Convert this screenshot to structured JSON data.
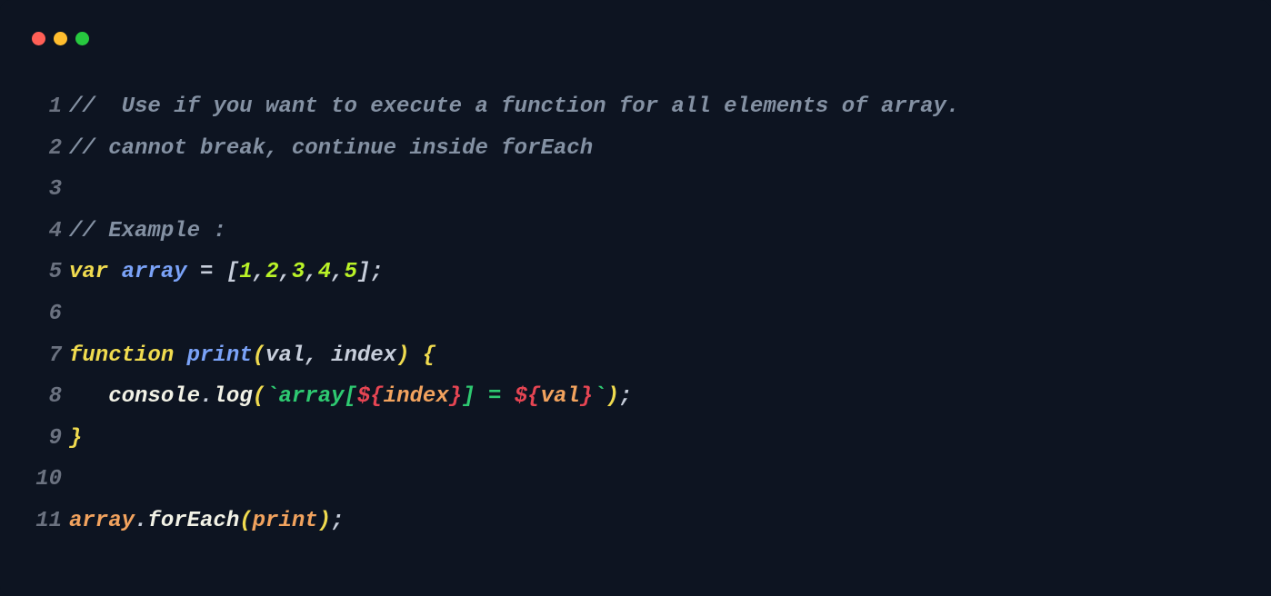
{
  "window": {
    "traffic_lights": [
      "close",
      "minimize",
      "maximize"
    ]
  },
  "code": {
    "lines": [
      {
        "n": "1",
        "tokens": [
          {
            "c": "tok-comment",
            "t": "//  Use if you want to execute a function for all elements of array."
          }
        ]
      },
      {
        "n": "2",
        "tokens": [
          {
            "c": "tok-comment",
            "t": "// cannot break, continue inside forEach"
          }
        ]
      },
      {
        "n": "3",
        "tokens": []
      },
      {
        "n": "4",
        "tokens": [
          {
            "c": "tok-comment",
            "t": "// Example :"
          }
        ]
      },
      {
        "n": "5",
        "tokens": [
          {
            "c": "tok-keyword",
            "t": "var"
          },
          {
            "c": "tok-default",
            "t": " "
          },
          {
            "c": "tok-var",
            "t": "array"
          },
          {
            "c": "tok-default",
            "t": " "
          },
          {
            "c": "tok-punct",
            "t": "="
          },
          {
            "c": "tok-default",
            "t": " "
          },
          {
            "c": "tok-punct",
            "t": "["
          },
          {
            "c": "tok-number",
            "t": "1"
          },
          {
            "c": "tok-punct",
            "t": ","
          },
          {
            "c": "tok-number",
            "t": "2"
          },
          {
            "c": "tok-punct",
            "t": ","
          },
          {
            "c": "tok-number",
            "t": "3"
          },
          {
            "c": "tok-punct",
            "t": ","
          },
          {
            "c": "tok-number",
            "t": "4"
          },
          {
            "c": "tok-punct",
            "t": ","
          },
          {
            "c": "tok-number",
            "t": "5"
          },
          {
            "c": "tok-punct",
            "t": "];"
          }
        ]
      },
      {
        "n": "6",
        "tokens": []
      },
      {
        "n": "7",
        "tokens": [
          {
            "c": "tok-keyword",
            "t": "function"
          },
          {
            "c": "tok-default",
            "t": " "
          },
          {
            "c": "tok-funcname",
            "t": "print"
          },
          {
            "c": "tok-paren",
            "t": "("
          },
          {
            "c": "tok-param",
            "t": "val"
          },
          {
            "c": "tok-punct",
            "t": ","
          },
          {
            "c": "tok-default",
            "t": " "
          },
          {
            "c": "tok-param",
            "t": "index"
          },
          {
            "c": "tok-paren",
            "t": ")"
          },
          {
            "c": "tok-default",
            "t": " "
          },
          {
            "c": "tok-brace",
            "t": "{"
          }
        ]
      },
      {
        "n": "8",
        "tokens": [
          {
            "c": "tok-default",
            "t": "   "
          },
          {
            "c": "tok-obj",
            "t": "console"
          },
          {
            "c": "tok-punct",
            "t": "."
          },
          {
            "c": "tok-method",
            "t": "log"
          },
          {
            "c": "tok-paren",
            "t": "("
          },
          {
            "c": "tok-string",
            "t": "`array["
          },
          {
            "c": "tok-interp",
            "t": "${"
          },
          {
            "c": "tok-identifier",
            "t": "index"
          },
          {
            "c": "tok-interp",
            "t": "}"
          },
          {
            "c": "tok-string",
            "t": "] = "
          },
          {
            "c": "tok-interp",
            "t": "${"
          },
          {
            "c": "tok-identifier",
            "t": "val"
          },
          {
            "c": "tok-interp",
            "t": "}"
          },
          {
            "c": "tok-string",
            "t": "`"
          },
          {
            "c": "tok-paren",
            "t": ")"
          },
          {
            "c": "tok-punct",
            "t": ";"
          }
        ]
      },
      {
        "n": "9",
        "tokens": [
          {
            "c": "tok-brace",
            "t": "}"
          }
        ]
      },
      {
        "n": "10",
        "tokens": []
      },
      {
        "n": "11",
        "tokens": [
          {
            "c": "tok-identifier",
            "t": "array"
          },
          {
            "c": "tok-punct",
            "t": "."
          },
          {
            "c": "tok-method",
            "t": "forEach"
          },
          {
            "c": "tok-paren",
            "t": "("
          },
          {
            "c": "tok-identifier",
            "t": "print"
          },
          {
            "c": "tok-paren",
            "t": ")"
          },
          {
            "c": "tok-punct",
            "t": ";"
          }
        ]
      }
    ]
  }
}
